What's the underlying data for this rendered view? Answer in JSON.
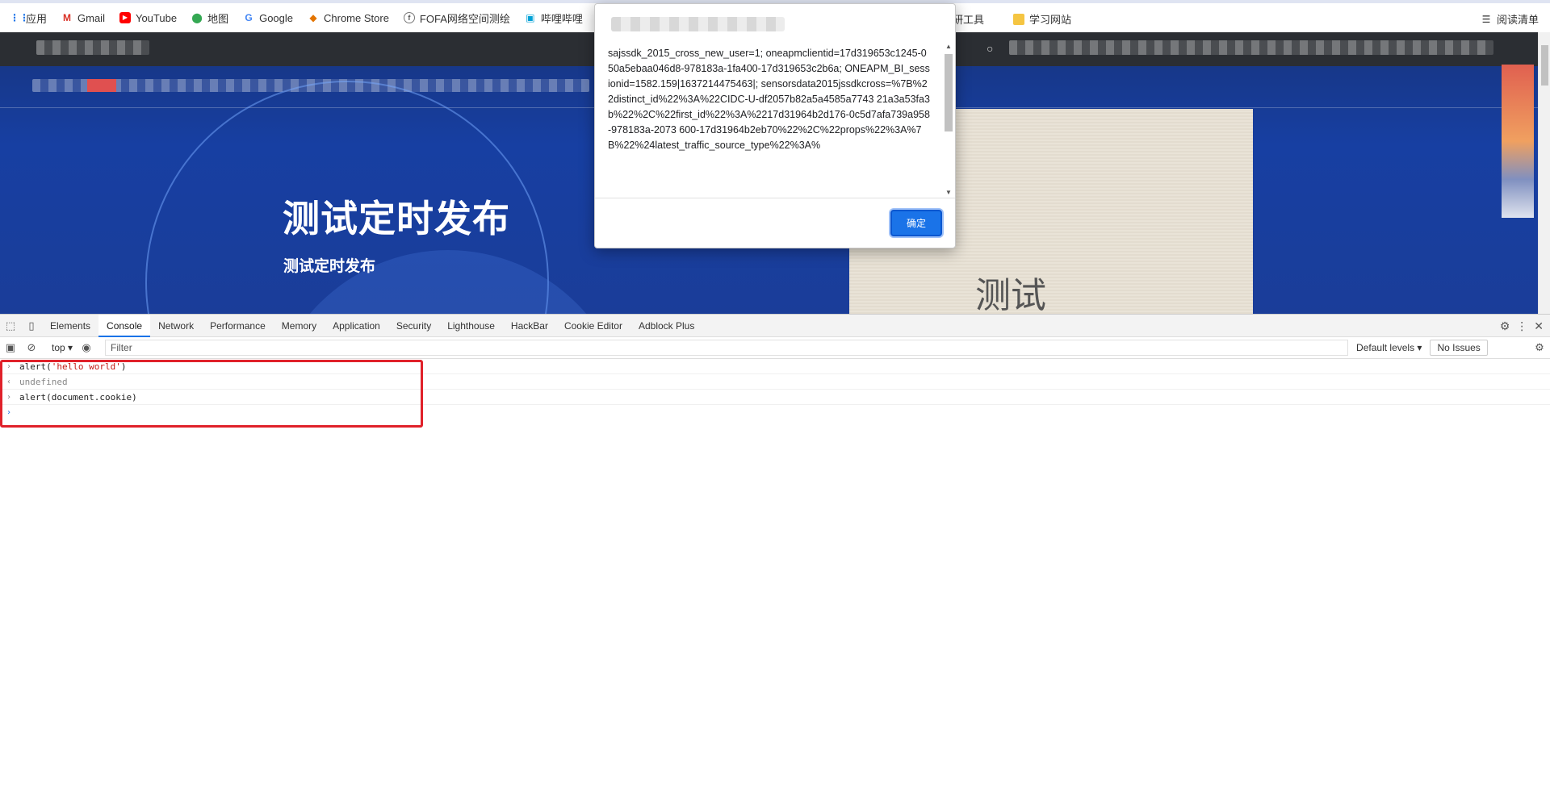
{
  "bookmarks": {
    "items": [
      {
        "label": "应用",
        "icon": "apps-grid-icon",
        "color": "#1a73e8"
      },
      {
        "label": "Gmail",
        "icon": "gmail-icon",
        "color": "#d93025"
      },
      {
        "label": "YouTube",
        "icon": "youtube-icon",
        "color": "#ff0000"
      },
      {
        "label": "地图",
        "icon": "maps-pin-icon",
        "color": "#34a853"
      },
      {
        "label": "Google",
        "icon": "google-icon",
        "color": "#4285f4"
      },
      {
        "label": "Chrome Store",
        "icon": "chrome-store-icon",
        "color": "#e37400"
      },
      {
        "label": "FOFA网络空间测绘",
        "icon": "fofa-icon",
        "color": "#555555"
      },
      {
        "label": "哔哩哔哩",
        "icon": "bilibili-icon",
        "color": "#00a1d6"
      }
    ],
    "extra": [
      "研工具",
      "学习网站"
    ],
    "reading_list": "阅读清单"
  },
  "webpage": {
    "hero_title": "测试定时发布",
    "hero_subtitle": "测试定时发布",
    "card_text": "测试"
  },
  "alert": {
    "message": "sajssdk_2015_cross_new_user=1; oneapmclientid=17d319653c1245-050a5ebaa046d8-978183a-1fa400-17d319653c2b6a; ONEAPM_BI_sessionid=1582.159|1637214475463|; sensorsdata2015jssdkcross=%7B%22distinct_id%22%3A%22CIDC-U-df2057b82a5a4585a7743 21a3a53fa3b%22%2C%22first_id%22%3A%2217d31964b2d176-0c5d7afa739a958-978183a-2073 600-17d31964b2eb70%22%2C%22props%22%3A%7B%22%24latest_traffic_source_type%22%3A%",
    "ok_label": "确定"
  },
  "devtools": {
    "tabs": [
      "Elements",
      "Console",
      "Network",
      "Performance",
      "Memory",
      "Application",
      "Security",
      "Lighthouse",
      "HackBar",
      "Cookie Editor",
      "Adblock Plus"
    ],
    "active_tab": "Console",
    "context": "top",
    "filter_placeholder": "Filter",
    "levels_label": "Default levels",
    "issues_label": "No Issues",
    "console_lines": [
      {
        "type": "input",
        "text_pre": "alert(",
        "text_str": "'hello world'",
        "text_post": ")"
      },
      {
        "type": "result",
        "text": "undefined"
      },
      {
        "type": "input",
        "text": "alert(document.cookie)"
      }
    ]
  },
  "colors": {
    "highlight_border": "#e0212a",
    "accent": "#1a73e8",
    "page_bg": "#173fa2"
  }
}
